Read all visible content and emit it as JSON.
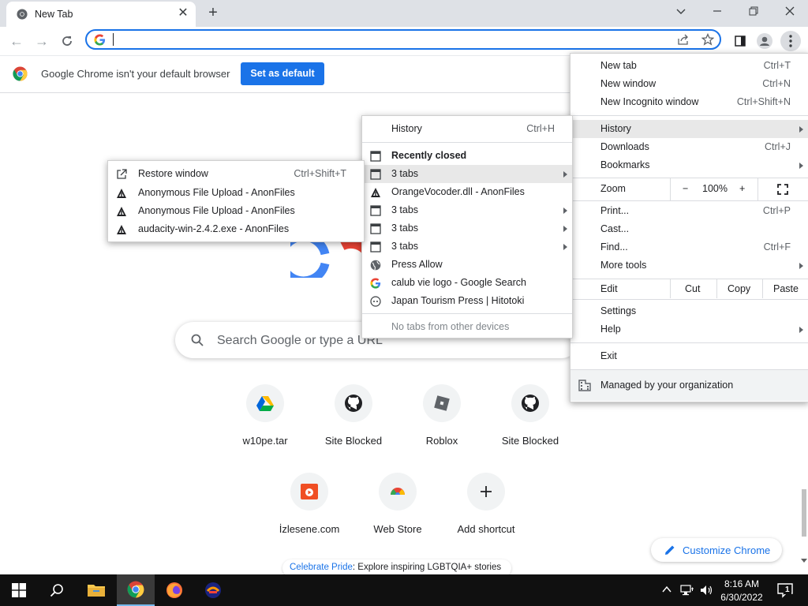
{
  "window": {
    "tab_title": "New Tab",
    "new_tab_icon": "plus-icon"
  },
  "infobar": {
    "message": "Google Chrome isn't your default browser",
    "button": "Set as default"
  },
  "search": {
    "placeholder": "Search Google or type a URL"
  },
  "shortcuts": [
    {
      "label": "w10pe.tar",
      "icon": "google-drive-icon"
    },
    {
      "label": "Site Blocked",
      "icon": "github-icon"
    },
    {
      "label": "Roblox",
      "icon": "roblox-icon"
    },
    {
      "label": "Site Blocked",
      "icon": "github-icon"
    },
    {
      "label": "İzlesene.com",
      "icon": "izlesene-icon"
    },
    {
      "label": "Web Store",
      "icon": "chrome-web-store-icon"
    },
    {
      "label": "Add shortcut",
      "icon": "plus-icon"
    }
  ],
  "customize": {
    "label": "Customize Chrome"
  },
  "pride": {
    "link": "Celebrate Pride",
    "text": ": Explore inspiring LGBTQIA+ stories"
  },
  "chrome_menu": {
    "new_tab": {
      "label": "New tab",
      "shortcut": "Ctrl+T"
    },
    "new_window": {
      "label": "New window",
      "shortcut": "Ctrl+N"
    },
    "new_incognito": {
      "label": "New Incognito window",
      "shortcut": "Ctrl+Shift+N"
    },
    "history": {
      "label": "History"
    },
    "downloads": {
      "label": "Downloads",
      "shortcut": "Ctrl+J"
    },
    "bookmarks": {
      "label": "Bookmarks"
    },
    "zoom": {
      "label": "Zoom",
      "minus": "−",
      "value": "100%",
      "plus": "+"
    },
    "print": {
      "label": "Print...",
      "shortcut": "Ctrl+P"
    },
    "cast": {
      "label": "Cast..."
    },
    "find": {
      "label": "Find...",
      "shortcut": "Ctrl+F"
    },
    "more_tools": {
      "label": "More tools"
    },
    "edit": {
      "label": "Edit",
      "cut": "Cut",
      "copy": "Copy",
      "paste": "Paste"
    },
    "settings": {
      "label": "Settings"
    },
    "help": {
      "label": "Help"
    },
    "exit": {
      "label": "Exit"
    },
    "managed": {
      "label": "Managed by your organization"
    }
  },
  "history_menu": {
    "history": {
      "label": "History",
      "shortcut": "Ctrl+H"
    },
    "recently_closed": "Recently closed",
    "items": [
      {
        "label": "3 tabs",
        "icon": "window-icon",
        "submenu": true
      },
      {
        "label": "OrangeVocoder.dll - AnonFiles",
        "icon": "anonfiles-icon",
        "submenu": false
      },
      {
        "label": "3 tabs",
        "icon": "window-icon",
        "submenu": true
      },
      {
        "label": "3 tabs",
        "icon": "window-icon",
        "submenu": true
      },
      {
        "label": "3 tabs",
        "icon": "window-icon",
        "submenu": true
      },
      {
        "label": "Press Allow",
        "icon": "globe-icon",
        "submenu": false
      },
      {
        "label": "calub vie logo - Google Search",
        "icon": "google-icon",
        "submenu": false
      },
      {
        "label": "Japan Tourism Press | Hitotoki",
        "icon": "hitotoki-icon",
        "submenu": false
      }
    ],
    "no_tabs": "No tabs from other devices"
  },
  "tabs_submenu": {
    "restore": {
      "label": "Restore window",
      "shortcut": "Ctrl+Shift+T"
    },
    "items": [
      {
        "label": "Anonymous File Upload - AnonFiles"
      },
      {
        "label": "Anonymous File Upload - AnonFiles"
      },
      {
        "label": "audacity-win-2.4.2.exe - AnonFiles"
      }
    ]
  },
  "taskbar": {
    "time": "8:16 AM",
    "date": "6/30/2022",
    "notification_count": "1"
  },
  "colors": {
    "accent": "#1a73e8",
    "titlebar": "#dee1e6",
    "taskbar": "#101010",
    "highlight": "#e8e8e8"
  }
}
